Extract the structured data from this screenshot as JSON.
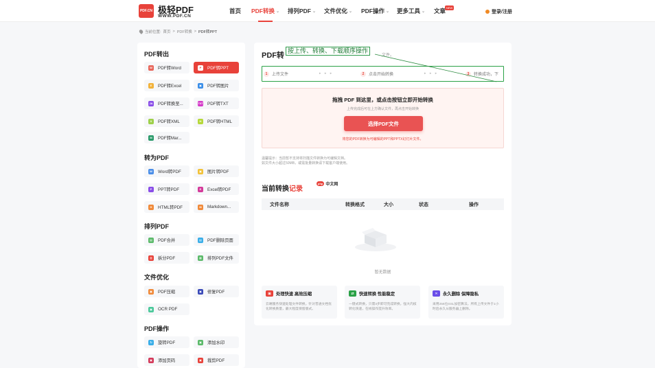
{
  "header": {
    "logo_mark": "PDF.CN",
    "logo_title": "极轻PDF",
    "logo_sub": "WWW.PDF.CN",
    "nav": [
      {
        "label": "首页",
        "chevron": ""
      },
      {
        "label": "PDF转换",
        "chevron": "⌄"
      },
      {
        "label": "排列PDF",
        "chevron": "⌄"
      },
      {
        "label": "文件优化",
        "chevron": "⌄"
      },
      {
        "label": "PDF操作",
        "chevron": "⌄"
      },
      {
        "label": "更多工具",
        "chevron": "⌄"
      },
      {
        "label": "文章",
        "chevron": ""
      }
    ],
    "new_badge": "NEW",
    "login": "登录/注册",
    "accent": "#e8423a"
  },
  "breadcrumb": {
    "prefix": "当前位置:",
    "home": "首页",
    "sep": ">",
    "level1": "PDF转换",
    "current": "PDF转PPT"
  },
  "sidebar": {
    "sections": [
      {
        "title": "PDF转出",
        "items": [
          {
            "label": "PDF转Word",
            "icon": "W",
            "color": "#e8665a"
          },
          {
            "label": "PDF转PPT",
            "icon": "P",
            "color": "#5cba6a"
          },
          {
            "label": "PDF转Excel",
            "icon": "E",
            "color": "#f2b23a"
          },
          {
            "label": "PDF转图片",
            "icon": "▣",
            "color": "#3a8ee8"
          },
          {
            "label": "PDF转换至...",
            "icon": "JA",
            "color": "#8a4ee8"
          },
          {
            "label": "PDF转TXT",
            "icon": "TXT",
            "color": "#d43ac8"
          },
          {
            "label": "PDF转XML",
            "icon": "X",
            "color": "#9ed04a"
          },
          {
            "label": "PDF转HTML",
            "icon": "H",
            "color": "#b6d83a"
          },
          {
            "label": "PDF转Mar...",
            "icon": "M",
            "color": "#2a9a6a"
          }
        ]
      },
      {
        "title": "转为PDF",
        "items": [
          {
            "label": "Word转PDF",
            "icon": "W",
            "color": "#4a8ee8"
          },
          {
            "label": "图片转PDF",
            "icon": "▣",
            "color": "#f2c23a"
          },
          {
            "label": "PPT转PDF",
            "icon": "P",
            "color": "#8a4ee8"
          },
          {
            "label": "Excel转PDF",
            "icon": "E",
            "color": "#d43a9a"
          },
          {
            "label": "HTML转PDF",
            "icon": "H",
            "color": "#f08a3a"
          },
          {
            "label": "Markdown...",
            "icon": "M",
            "color": "#f08a3a"
          }
        ]
      },
      {
        "title": "排列PDF",
        "items": [
          {
            "label": "PDF合并",
            "icon": "▤",
            "color": "#5cba6a"
          },
          {
            "label": "PDF删除页面",
            "icon": "▤",
            "color": "#3aaee8"
          },
          {
            "label": "拆分PDF",
            "icon": "▥",
            "color": "#e8423a"
          },
          {
            "label": "排列PDF文件",
            "icon": "▦",
            "color": "#5cba6a"
          }
        ]
      },
      {
        "title": "文件优化",
        "items": [
          {
            "label": "PDF压缩",
            "icon": "▣",
            "color": "#f08a3a"
          },
          {
            "label": "修复PDF",
            "icon": "▣",
            "color": "#3a4ab8"
          },
          {
            "label": "OCR PDF",
            "icon": "▣",
            "color": "#4ac89a"
          }
        ]
      },
      {
        "title": "PDF操作",
        "items": [
          {
            "label": "旋转PDF",
            "icon": "↻",
            "color": "#3aaee8"
          },
          {
            "label": "添加水印",
            "icon": "▣",
            "color": "#5cba6a"
          },
          {
            "label": "添加页码",
            "icon": "▣",
            "color": "#d43a5a"
          },
          {
            "label": "裁剪PDF",
            "icon": "▣",
            "color": "#e8423a"
          }
        ]
      }
    ]
  },
  "main": {
    "title": "PDF转",
    "title_tail": "文件。",
    "callout": "按上传、转换、下载顺序操作",
    "steps": [
      {
        "num": "1",
        "label": "上传文件"
      },
      {
        "num": "2",
        "label": "点击开始转换"
      },
      {
        "num": "3",
        "label": "转换成功，下"
      }
    ],
    "step_arrows": "▸ ▸ ▸",
    "dropzone": {
      "title": "拖拽 PDF 到这里，或点击按钮立即开始转换",
      "subtitle": "上传完成后可在上方确认文件，再点击开始转换",
      "button": "选择PDF文件",
      "note": "将您的PDF转换为可编辑的PPT和PPTX幻灯片文件。"
    },
    "tips": [
      "温馨提示：当前暂不支持将扫描文件转换为可编辑文档。",
      "如文件大小超过50MB，或需批量转换请下载客户端使用。"
    ],
    "records": {
      "title_plain": "当前转换",
      "title_accent": "记录",
      "php_badge": "php",
      "php_label": "中文网",
      "columns": [
        "文件名称",
        "转换格式",
        "大小",
        "状态",
        "操作"
      ],
      "empty": "暂无数据"
    },
    "features": [
      {
        "title": "处理快速 高效压缩",
        "icon_color": "#e8423a",
        "desc": "云端服务快速处理文件转换，针对普通文档优化转换质量，最大程度保留版式。"
      },
      {
        "title": "快速转换 性能稳定",
        "icon_color": "#2aa146",
        "desc": "一键式转换，只需3步即可完成转换，强大内核转化快速，在线操作提升效率。"
      },
      {
        "title": "永久删除 保障隐私",
        "icon_color": "#6a4ee8",
        "desc": "采用256位SSL加密算法，所有上传文件于1小时后永久从服务器上删除。"
      }
    ]
  }
}
